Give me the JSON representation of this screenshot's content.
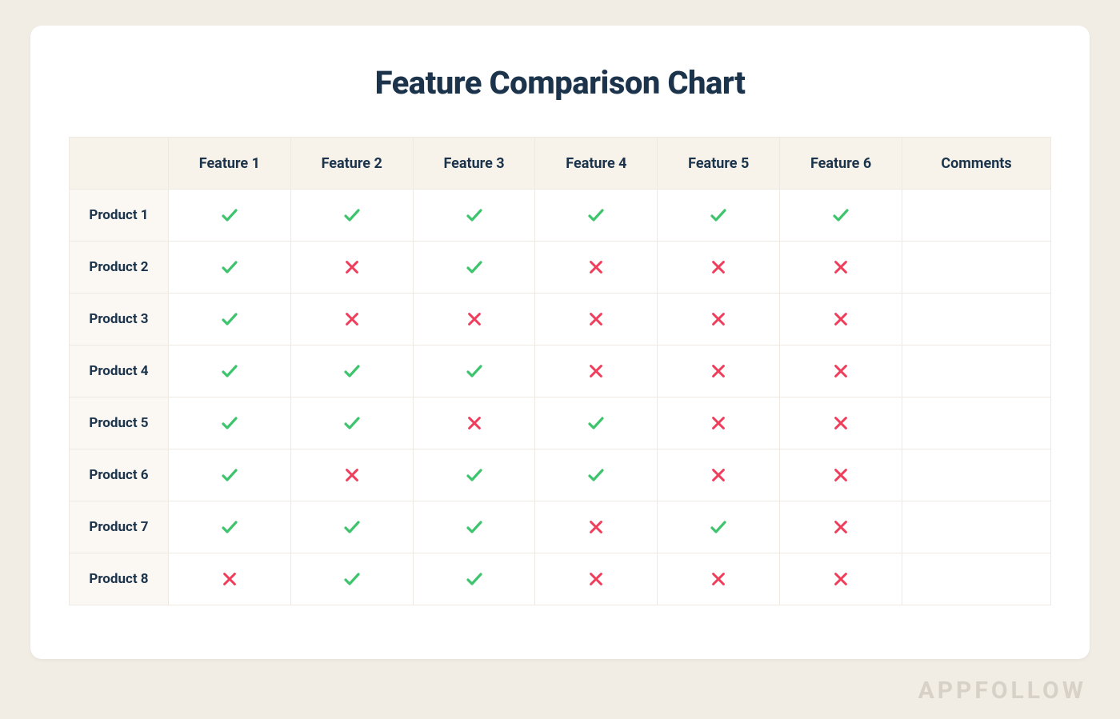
{
  "title": "Feature Comparison Chart",
  "watermark": "APPFOLLOW",
  "columns": {
    "blank": "",
    "f1": "Feature 1",
    "f2": "Feature 2",
    "f3": "Feature 3",
    "f4": "Feature 4",
    "f5": "Feature 5",
    "f6": "Feature 6",
    "comments": "Comments"
  },
  "rows": {
    "p1": "Product 1",
    "p2": "Product 2",
    "p3": "Product 3",
    "p4": "Product 4",
    "p5": "Product 5",
    "p6": "Product 6",
    "p7": "Product 7",
    "p8": "Product 8"
  },
  "colors": {
    "check": "#3ec46d",
    "cross": "#ef3e5c"
  },
  "chart_data": {
    "type": "table",
    "title": "Feature Comparison Chart",
    "columns": [
      "Feature 1",
      "Feature 2",
      "Feature 3",
      "Feature 4",
      "Feature 5",
      "Feature 6",
      "Comments"
    ],
    "rows": [
      {
        "name": "Product 1",
        "values": [
          true,
          true,
          true,
          true,
          true,
          true
        ],
        "comment": ""
      },
      {
        "name": "Product 2",
        "values": [
          true,
          false,
          true,
          false,
          false,
          false
        ],
        "comment": ""
      },
      {
        "name": "Product 3",
        "values": [
          true,
          false,
          false,
          false,
          false,
          false
        ],
        "comment": ""
      },
      {
        "name": "Product 4",
        "values": [
          true,
          true,
          true,
          false,
          false,
          false
        ],
        "comment": ""
      },
      {
        "name": "Product 5",
        "values": [
          true,
          true,
          false,
          true,
          false,
          false
        ],
        "comment": ""
      },
      {
        "name": "Product 6",
        "values": [
          true,
          false,
          true,
          true,
          false,
          false
        ],
        "comment": ""
      },
      {
        "name": "Product 7",
        "values": [
          true,
          true,
          true,
          false,
          true,
          false
        ],
        "comment": ""
      },
      {
        "name": "Product 8",
        "values": [
          false,
          true,
          true,
          false,
          false,
          false
        ],
        "comment": ""
      }
    ]
  }
}
